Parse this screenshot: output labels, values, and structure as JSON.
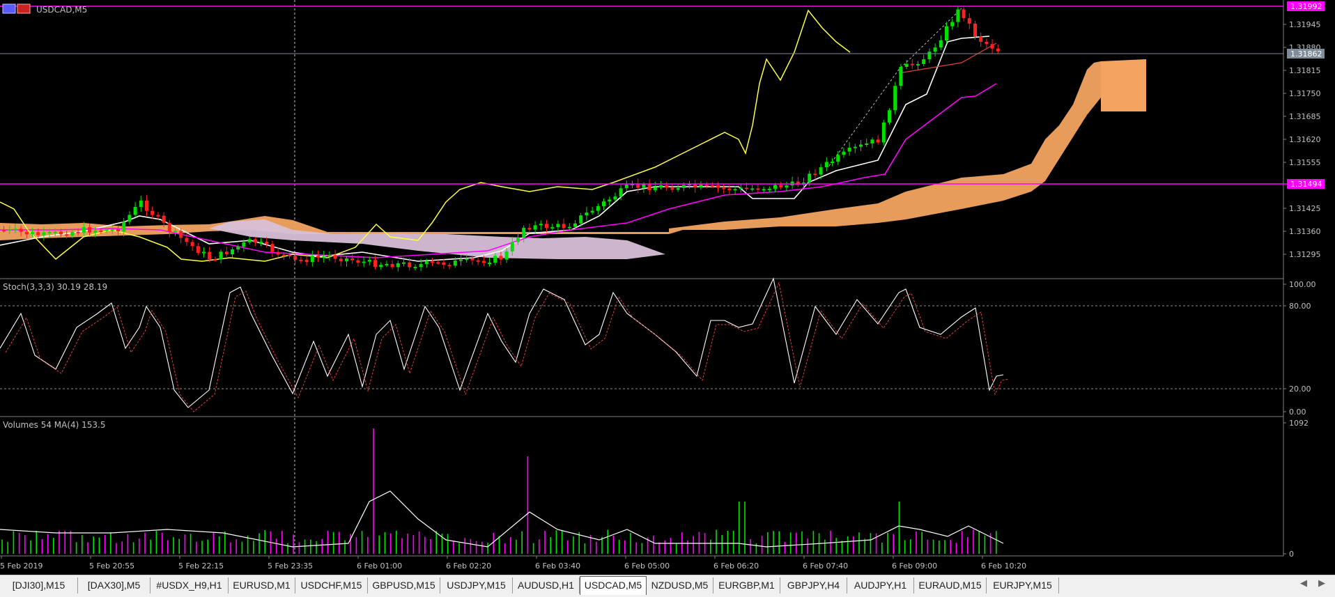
{
  "window": {
    "symbol_label": "USDCAD,M5"
  },
  "main_chart": {
    "price_ticks": [
      "1.31945",
      "1.31880",
      "1.31815",
      "1.31750",
      "1.31685",
      "1.31620",
      "1.31555",
      "1.31425",
      "1.31360",
      "1.31295"
    ],
    "marker_high": "1.31992",
    "marker_current": "1.31862",
    "marker_level": "1.31494",
    "colors": {
      "bull": "#00e000",
      "bear": "#ff2020",
      "tenkan": "#ffffff",
      "kijun": "#ff00ff",
      "chikou": "#ffff44",
      "cloud_up": "#f4a460",
      "cloud_down": "#d8bfd8",
      "level_line": "#ff00ff"
    }
  },
  "stoch": {
    "label": "Stoch(3,3,3) 30.19 28.19",
    "ticks": [
      "100.00",
      "80.00",
      "20.00",
      "0.00"
    ]
  },
  "volumes": {
    "label": "Volumes 54 MA(4) 153.5",
    "ticks": [
      "1092",
      "0"
    ]
  },
  "time_axis": {
    "labels": [
      "5 Feb 2019",
      "5 Feb 20:55",
      "5 Feb 22:15",
      "5 Feb 23:35",
      "6 Feb 01:00",
      "6 Feb 02:20",
      "6 Feb 03:40",
      "6 Feb 05:00",
      "6 Feb 06:20",
      "6 Feb 07:40",
      "6 Feb 09:00",
      "6 Feb 10:20"
    ]
  },
  "tabs": [
    {
      "label": "[DJI30],M15",
      "active": false
    },
    {
      "label": "[DAX30],M5",
      "active": false
    },
    {
      "label": "#USDX_H9,H1",
      "active": false
    },
    {
      "label": "EURUSD,M1",
      "active": false
    },
    {
      "label": "USDCHF,M15",
      "active": false
    },
    {
      "label": "GBPUSD,M15",
      "active": false
    },
    {
      "label": "USDJPY,M15",
      "active": false
    },
    {
      "label": "AUDUSD,H1",
      "active": false
    },
    {
      "label": "USDCAD,M5",
      "active": true
    },
    {
      "label": "NZDUSD,M5",
      "active": false
    },
    {
      "label": "EURGBP,M1",
      "active": false
    },
    {
      "label": "GBPJPY,H4",
      "active": false
    },
    {
      "label": "AUDJPY,H1",
      "active": false
    },
    {
      "label": "EURAUD,M15",
      "active": false
    },
    {
      "label": "EURJPY,M15",
      "active": false
    }
  ]
}
